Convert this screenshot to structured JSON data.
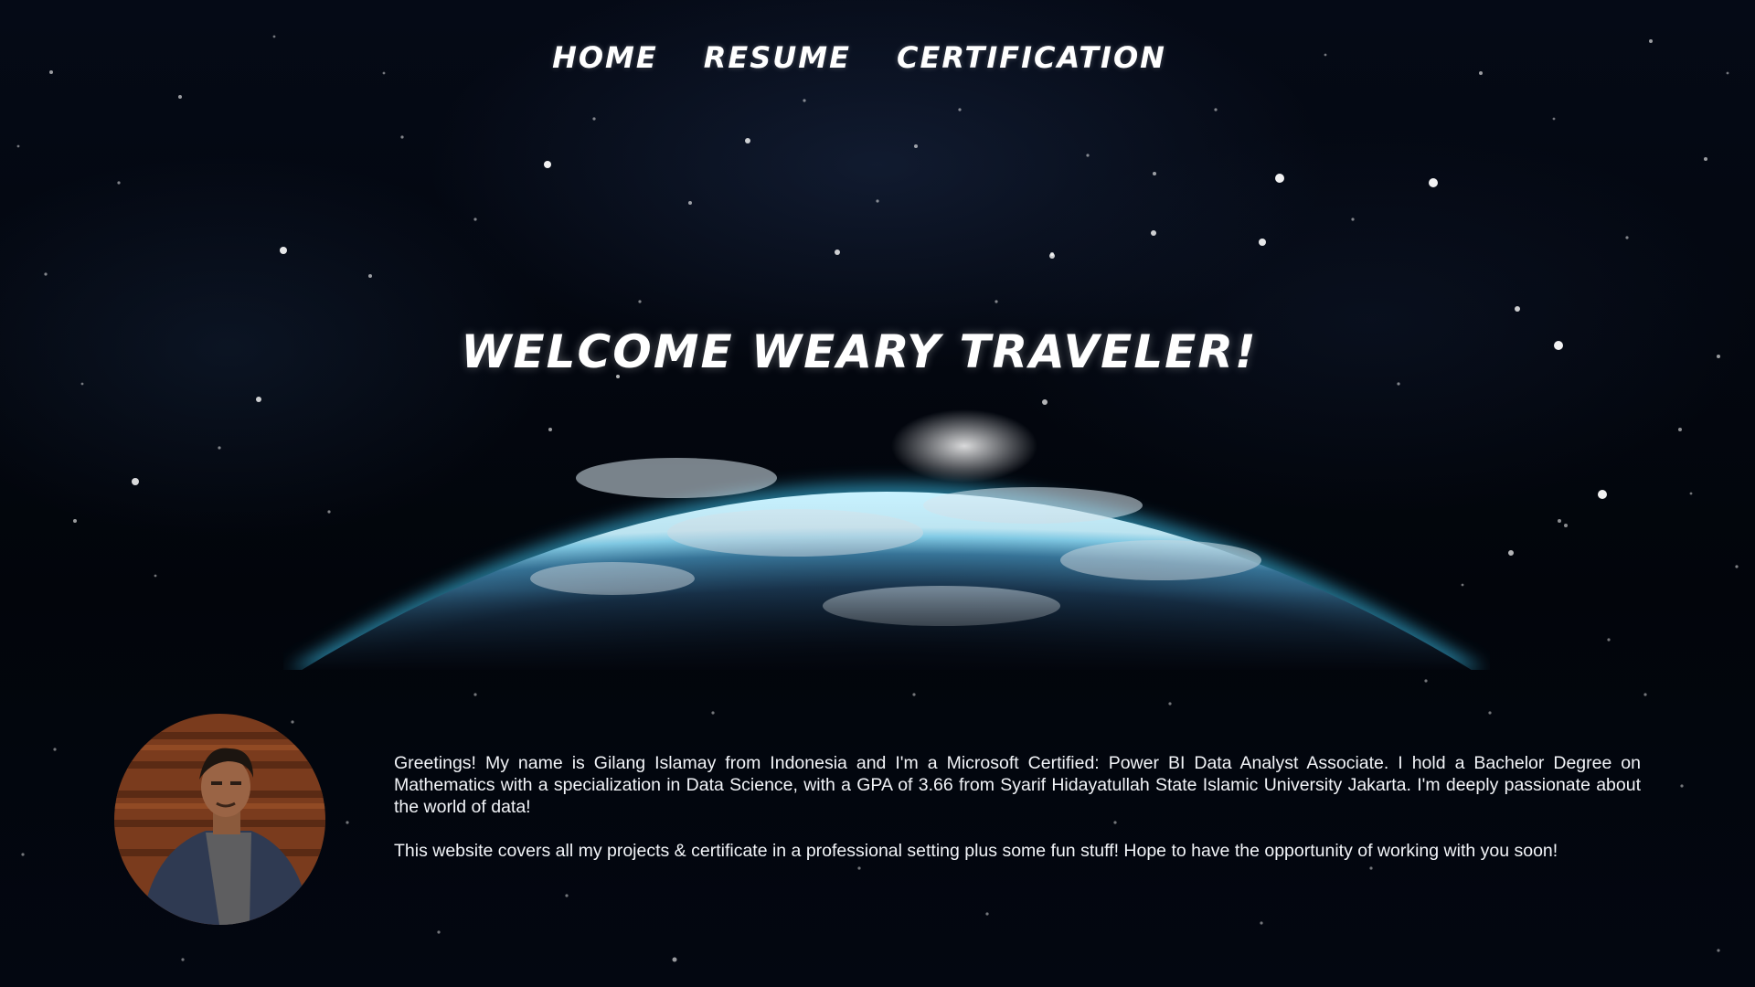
{
  "nav": {
    "items": [
      {
        "label": "HOME"
      },
      {
        "label": "RESUME"
      },
      {
        "label": "CERTIFICATION"
      }
    ]
  },
  "hero": {
    "title": "WELCOME WEARY TRAVELER!"
  },
  "about": {
    "paragraph_1": "Greetings! My name is Gilang Islamay from Indonesia and I'm a Microsoft Certified: Power BI Data Analyst Associate. I hold a Bachelor Degree on Mathematics with a specialization in Data Science, with a GPA of 3.66 from Syarif Hidayatullah State Islamic University Jakarta. I'm deeply passionate about the world of data!",
    "paragraph_2": "This website covers all my projects & certificate in a professional setting plus some fun stuff! Hope to have the opportunity of working with you soon!"
  },
  "colors": {
    "background": "#03060d",
    "text": "#ffffff",
    "atmosphere_glow": "#3fd0ff"
  },
  "icons": {
    "background": "starfield-image",
    "hero": "earth-horizon-image",
    "profile": "profile-photo"
  }
}
